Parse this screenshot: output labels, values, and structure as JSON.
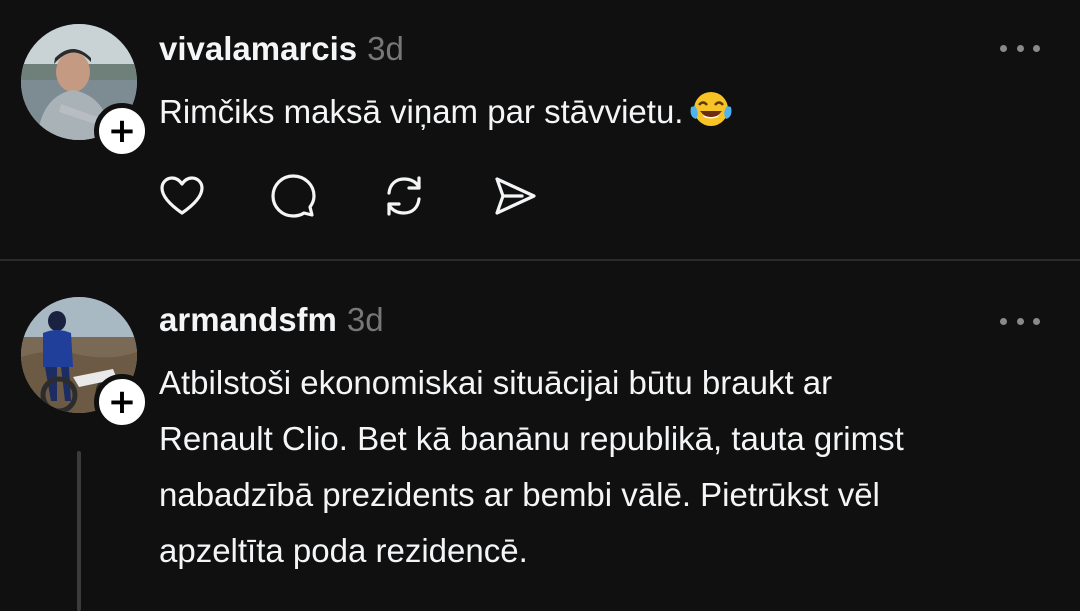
{
  "posts": [
    {
      "username": "vivalamarcis",
      "time": "3d",
      "text": "Rimčiks maksā viņam par stāvvietu.",
      "emoji": "face-with-tears-of-joy",
      "follow_label": "+"
    },
    {
      "username": "armandsfm",
      "time": "3d",
      "lines": [
        "Atbilstoši ekonomiskai situācijai būtu braukt ar",
        "Renault Clio. Bet kā banānu republikā, tauta grimst",
        "nabadzībā prezidents ar bembi vālē. Pietrūkst vēl",
        "apzeltīta poda rezidencē."
      ],
      "follow_label": "+"
    }
  ],
  "actions": [
    "heart-icon",
    "comment-icon",
    "repost-icon",
    "share-icon"
  ],
  "colors": {
    "background": "#101010",
    "text": "#f3f5f7",
    "muted": "#777777",
    "divider": "#2a2a2a"
  }
}
